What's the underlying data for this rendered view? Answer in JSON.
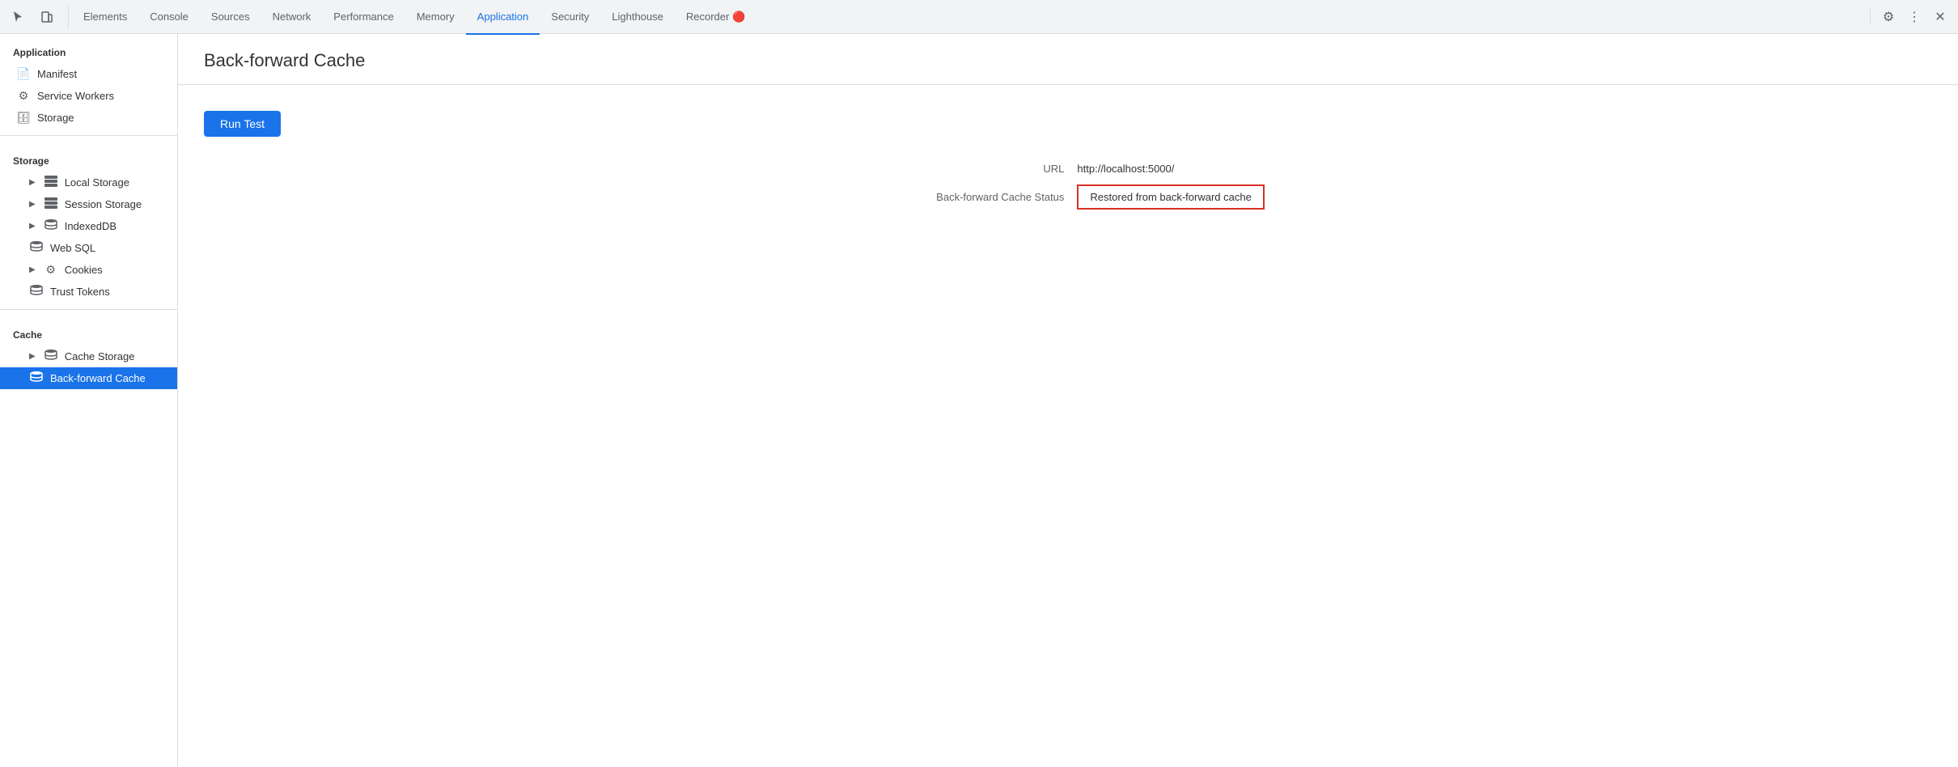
{
  "tabs": [
    {
      "id": "elements",
      "label": "Elements",
      "active": false
    },
    {
      "id": "console",
      "label": "Console",
      "active": false
    },
    {
      "id": "sources",
      "label": "Sources",
      "active": false
    },
    {
      "id": "network",
      "label": "Network",
      "active": false
    },
    {
      "id": "performance",
      "label": "Performance",
      "active": false
    },
    {
      "id": "memory",
      "label": "Memory",
      "active": false
    },
    {
      "id": "application",
      "label": "Application",
      "active": true
    },
    {
      "id": "security",
      "label": "Security",
      "active": false
    },
    {
      "id": "lighthouse",
      "label": "Lighthouse",
      "active": false
    },
    {
      "id": "recorder",
      "label": "Recorder 🔴",
      "active": false
    }
  ],
  "sidebar": {
    "application_section": "Application",
    "manifest_label": "Manifest",
    "service_workers_label": "Service Workers",
    "storage_label": "Storage",
    "storage_section": "Storage",
    "local_storage_label": "Local Storage",
    "session_storage_label": "Session Storage",
    "indexeddb_label": "IndexedDB",
    "web_sql_label": "Web SQL",
    "cookies_label": "Cookies",
    "trust_tokens_label": "Trust Tokens",
    "cache_section": "Cache",
    "cache_storage_label": "Cache Storage",
    "back_forward_cache_label": "Back-forward Cache"
  },
  "content": {
    "title": "Back-forward Cache",
    "run_test_button": "Run Test",
    "url_label": "URL",
    "url_value": "http://localhost:5000/",
    "status_label": "Back-forward Cache Status",
    "status_value": "Restored from back-forward cache"
  }
}
